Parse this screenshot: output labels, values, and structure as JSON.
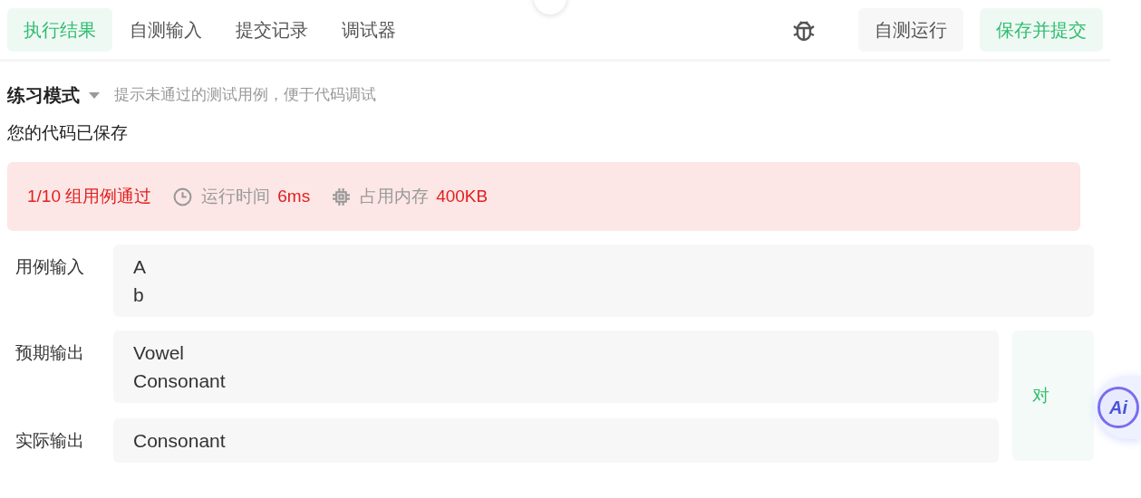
{
  "tabs": [
    {
      "label": "执行结果",
      "selected": true
    },
    {
      "label": "自测输入",
      "selected": false
    },
    {
      "label": "提交记录",
      "selected": false
    },
    {
      "label": "调试器",
      "selected": false
    }
  ],
  "actions": [
    {
      "label": "自测运行",
      "kind": "plain"
    },
    {
      "label": "保存并提交",
      "kind": "primary"
    }
  ],
  "mode": {
    "label": "练习模式",
    "hint": "提示未通过的测试用例，便于代码调试"
  },
  "save_status": "您的代码已保存",
  "result": {
    "passed": "1/10 组用例通过",
    "time_label": "运行时间",
    "time": "6ms",
    "memory_label": "占用内存",
    "memory": "400KB"
  },
  "cases": [
    {
      "label": "用例输入",
      "lines": [
        "A",
        "b"
      ]
    },
    {
      "label": "预期输出",
      "lines": [
        "Vowel",
        "Consonant"
      ]
    },
    {
      "label": "实际输出",
      "lines": [
        "Consonant"
      ]
    }
  ],
  "compare_button": "对",
  "ai_button": "Ai"
}
